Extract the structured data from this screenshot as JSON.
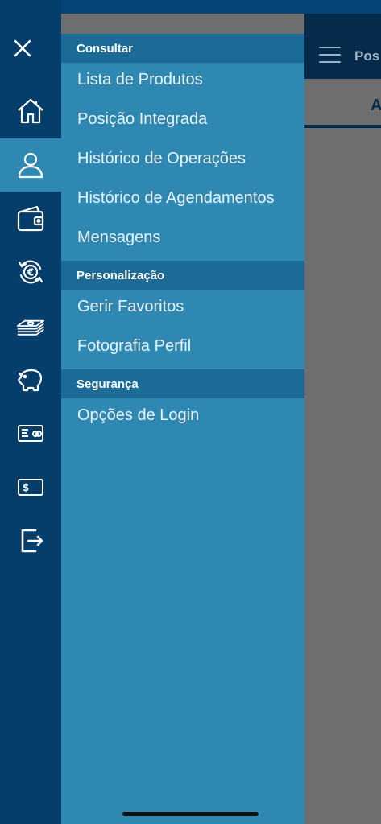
{
  "background": {
    "title": "Pos",
    "tab_label": "A"
  },
  "rail": {
    "icons": [
      "close-icon",
      "home-icon",
      "user-icon",
      "wallet-icon",
      "euro-exchange-icon",
      "banknotes-icon",
      "piggy-bank-icon",
      "credit-card-icon",
      "dollar-bill-icon",
      "logout-icon"
    ],
    "active": "user-icon"
  },
  "menu": {
    "sections": [
      {
        "title": "Consultar",
        "items": [
          "Lista de Produtos",
          "Posição Integrada",
          "Histórico de Operações",
          "Histórico de Agendamentos",
          "Mensagens"
        ]
      },
      {
        "title": "Personalização",
        "items": [
          "Gerir Favoritos",
          "Fotografia Perfil"
        ]
      },
      {
        "title": "Segurança",
        "items": [
          "Opções de Login"
        ]
      }
    ]
  },
  "colors": {
    "rail": "#053e6b",
    "panel": "#2f88b2",
    "section_header": "#1c6b96",
    "overlay": "#6e6e6e"
  }
}
